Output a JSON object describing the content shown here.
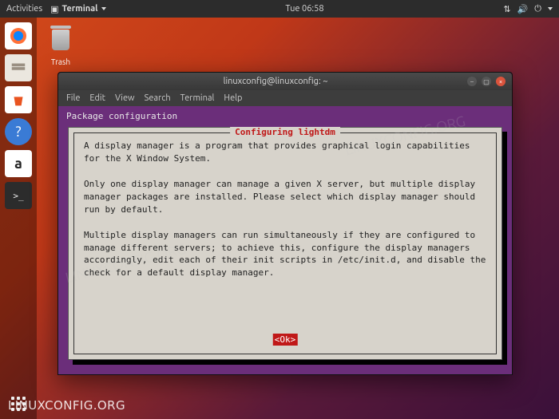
{
  "topbar": {
    "activities": "Activities",
    "app_name": "Terminal",
    "clock": "Tue 06:58"
  },
  "desktop": {
    "trash_label": "Trash"
  },
  "dock": {
    "items": [
      {
        "name": "firefox-icon",
        "glyph": "🦊"
      },
      {
        "name": "files-icon",
        "glyph": "🗄"
      },
      {
        "name": "software-icon",
        "glyph": "🛍"
      },
      {
        "name": "help-icon",
        "glyph": "❓"
      },
      {
        "name": "amazon-icon",
        "glyph": "a"
      },
      {
        "name": "terminal-icon",
        "glyph": ">_"
      }
    ]
  },
  "terminal": {
    "title": "linuxconfig@linuxconfig: ~",
    "menu": [
      "File",
      "Edit",
      "View",
      "Search",
      "Terminal",
      "Help"
    ]
  },
  "debconf": {
    "header": "Package configuration",
    "title": "Configuring lightdm",
    "body_p1": "A display manager is a program that provides graphical login capabilities for the X Window System.",
    "body_p2": "Only one display manager can manage a given X server, but multiple display manager packages are installed. Please select which display manager should run by default.",
    "body_p3": "Multiple display managers can run simultaneously if they are configured to manage different servers; to achieve this, configure the display managers accordingly, edit each of their init scripts in /etc/init.d, and disable the check for a default display manager.",
    "ok": "<Ok>"
  },
  "watermark": "LINUXCONFIG.ORG"
}
